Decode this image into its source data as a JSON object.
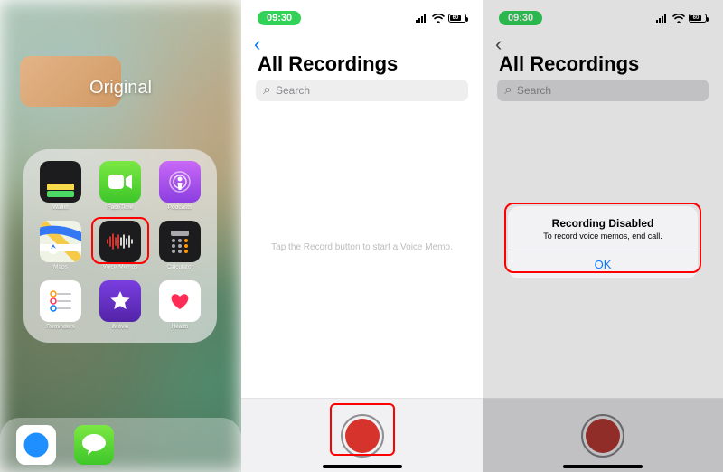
{
  "panel1": {
    "label": "Original",
    "apps": [
      {
        "name": "Wallet"
      },
      {
        "name": "FaceTime"
      },
      {
        "name": "Podcasts"
      },
      {
        "name": "Maps"
      },
      {
        "name": "Voice Memos"
      },
      {
        "name": "Calculator"
      },
      {
        "name": "Reminders"
      },
      {
        "name": "iMovie"
      },
      {
        "name": "Health"
      }
    ]
  },
  "shared": {
    "time": "09:30",
    "battery_percent": "60",
    "back_glyph": "‹",
    "title": "All Recordings",
    "search_placeholder": "Search",
    "search_icon": "⌕"
  },
  "panel2": {
    "hint": "Tap the Record button to start a Voice Memo."
  },
  "panel3": {
    "alert_title": "Recording Disabled",
    "alert_message": "To record voice memos, end call.",
    "alert_button": "OK"
  }
}
